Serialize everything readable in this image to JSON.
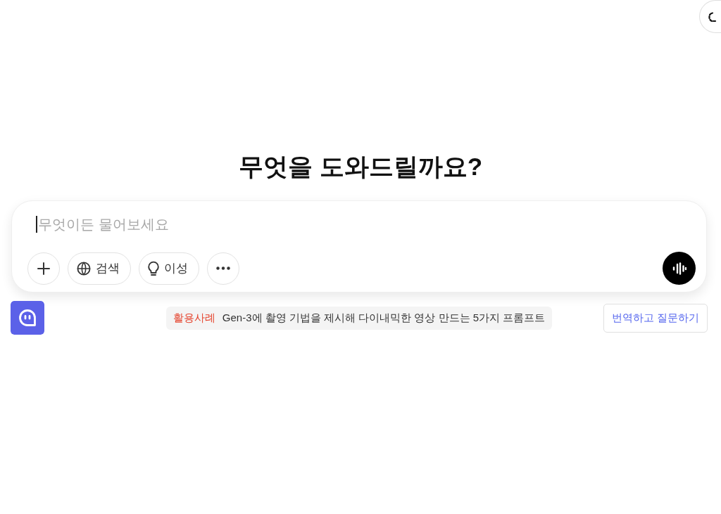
{
  "heading": "무엇을 도와드릴까요?",
  "composer": {
    "placeholder": "무엇이든 물어보세요",
    "tools": [
      {
        "kind": "add"
      },
      {
        "kind": "search",
        "label": "검색"
      },
      {
        "kind": "reason",
        "label": "이성"
      },
      {
        "kind": "more"
      }
    ]
  },
  "example": {
    "tag": "활용사례",
    "text": "Gen-3에 촬영 기법을 제시해 다이내믹한 영상 만드는 5가지 프롬프트"
  },
  "translate_button": "번역하고 질문하기"
}
